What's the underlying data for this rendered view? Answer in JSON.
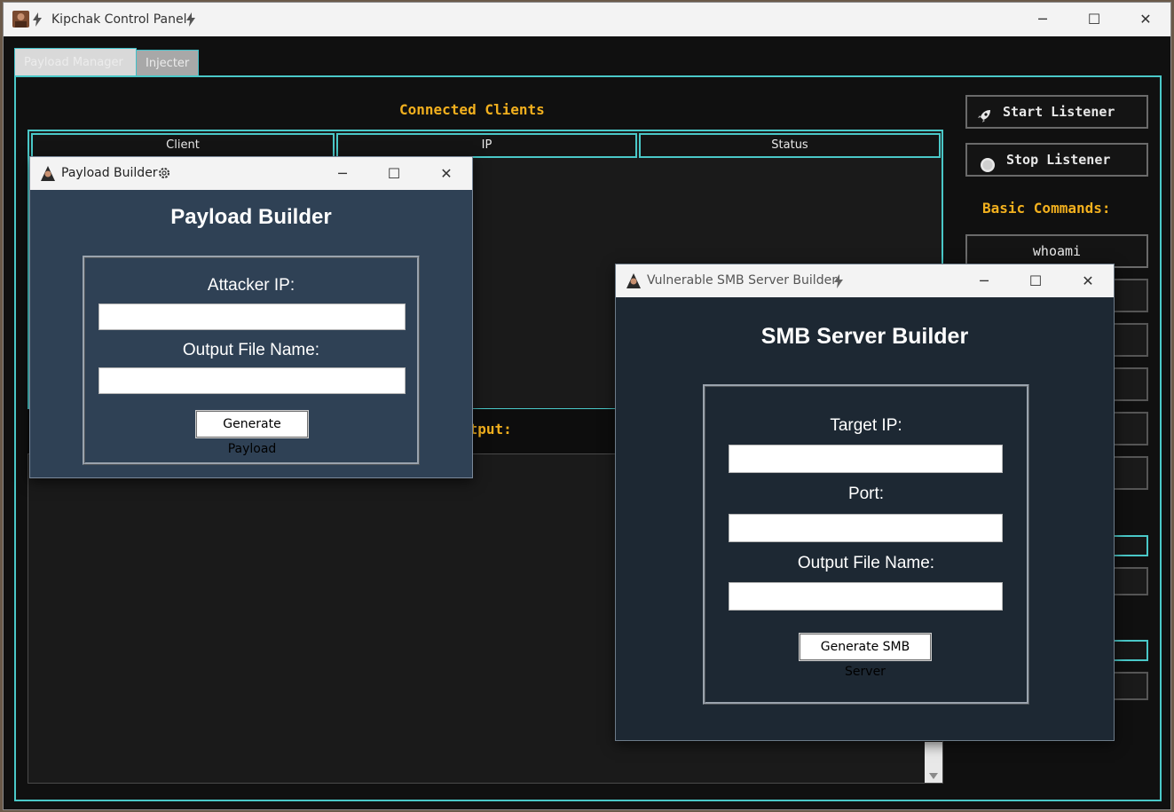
{
  "main_window": {
    "title": "Kipchak Control Panel",
    "minimize": "─",
    "maximize": "☐",
    "close": "✕",
    "tabs": [
      {
        "label": "Payload Manager"
      },
      {
        "label": "Injecter"
      }
    ],
    "connected_clients_heading": "Connected Clients",
    "columns": [
      "Client",
      "IP",
      "Status"
    ],
    "output_heading": "utput:",
    "start_listener": "Start Listener",
    "stop_listener": "Stop Listener",
    "basic_commands_heading": "Basic Commands:",
    "commands": [
      {
        "label": "whoami"
      }
    ]
  },
  "payload_builder": {
    "window_title": "Payload Builder",
    "heading": "Payload Builder",
    "attacker_ip_label": "Attacker IP:",
    "attacker_ip_value": "",
    "output_file_label": "Output File Name:",
    "output_file_value": "",
    "generate_label": "Generate Payload",
    "minimize": "─",
    "maximize": "☐",
    "close": "✕"
  },
  "smb_builder": {
    "window_title": "Vulnerable SMB Server Builder",
    "heading": "SMB Server Builder",
    "target_ip_label": "Target IP:",
    "target_ip_value": "",
    "port_label": "Port:",
    "port_value": "",
    "output_file_label": "Output File Name:",
    "output_file_value": "",
    "generate_label": "Generate SMB Server",
    "minimize": "─",
    "maximize": "☐",
    "close": "✕"
  },
  "icons": {
    "app": "hacker-avatar-icon",
    "lightning": "lightning-icon",
    "rocket": "rocket-icon",
    "stop": "stop-circle-icon",
    "gear": "gear-icon"
  },
  "colors": {
    "accent_cyan": "#4ac8c8",
    "heading_yellow": "#f2b01e",
    "payload_bg": "#2f4155",
    "smb_bg": "#1d2833"
  }
}
